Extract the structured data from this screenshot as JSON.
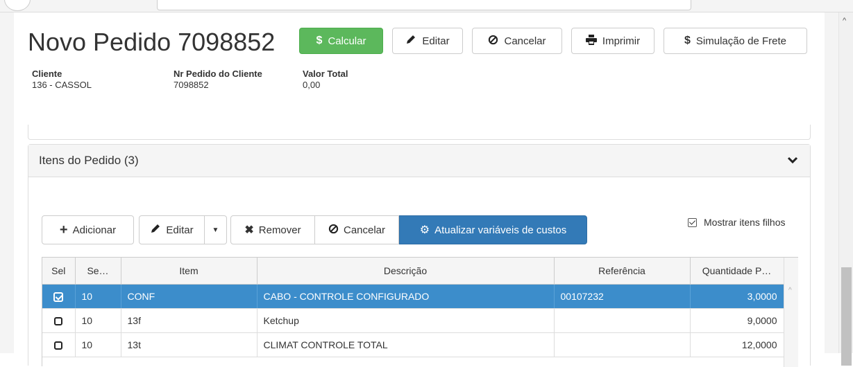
{
  "header": {
    "title": "Novo Pedido 7098852",
    "buttons": {
      "calcular": "Calcular",
      "editar": "Editar",
      "cancelar": "Cancelar",
      "imprimir": "Imprimir",
      "simulacao": "Simulação de Frete"
    }
  },
  "meta": {
    "cliente_label": "Cliente",
    "cliente_value": "136 - CASSOL",
    "nr_label": "Nr Pedido do Cliente",
    "nr_value": "7098852",
    "valor_label": "Valor Total",
    "valor_value": "0,00"
  },
  "items_panel": {
    "title": "Itens do Pedido (3)",
    "toolbar": {
      "adicionar": "Adicionar",
      "editar": "Editar",
      "remover": "Remover",
      "cancelar": "Cancelar",
      "atualizar": "Atualizar variáveis de custos"
    },
    "show_children_label": "Mostrar itens filhos",
    "show_children_checked": true,
    "columns": [
      "Sel",
      "Se…",
      "Item",
      "Descrição",
      "Referência",
      "Quantidade P…"
    ],
    "rows": [
      {
        "selected": true,
        "seq": "10",
        "item": "CONF",
        "descricao": "CABO - CONTROLE CONFIGURADO",
        "referencia": "00107232",
        "quantidade": "3,0000"
      },
      {
        "selected": false,
        "seq": "10",
        "item": "13f",
        "descricao": "Ketchup",
        "referencia": "",
        "quantidade": "9,0000"
      },
      {
        "selected": false,
        "seq": "10",
        "item": "13t",
        "descricao": "CLIMAT CONTROLE TOTAL",
        "referencia": "",
        "quantidade": "12,0000"
      }
    ]
  },
  "colors": {
    "success": "#5cb85c",
    "primary": "#337ab7",
    "selected_row": "#3c8dcb"
  }
}
